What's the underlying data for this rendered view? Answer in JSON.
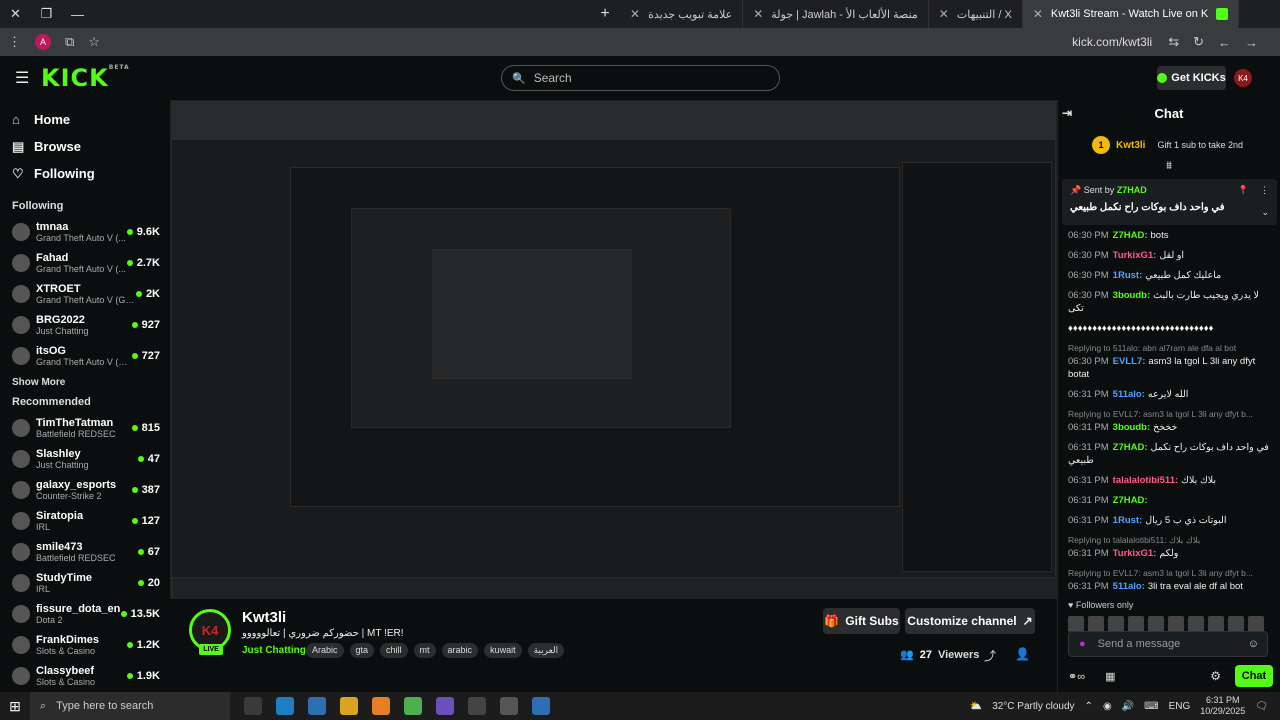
{
  "browser": {
    "tabs": [
      {
        "label": "علامة تبويب جديدة",
        "active": false
      },
      {
        "label": "جولة | Jawlah - منصة الألعاب الأ",
        "active": false
      },
      {
        "label": "التنبيهات / X",
        "active": false
      },
      {
        "label": "Kwt3li Stream - Watch Live on K",
        "active": true
      }
    ],
    "url": "kick.com/kwt3li",
    "profile_initial": "A"
  },
  "header": {
    "logo": "KICK",
    "beta": "BETA",
    "search_placeholder": "Search",
    "get_kicks": "Get KICKs",
    "user_avatar": "K4"
  },
  "sidebar": {
    "nav": [
      {
        "label": "Home",
        "icon": "home-icon"
      },
      {
        "label": "Browse",
        "icon": "browse-icon"
      },
      {
        "label": "Following",
        "icon": "heart-icon"
      }
    ],
    "following_title": "Following",
    "following": [
      {
        "name": "tmnaa",
        "game": "Grand Theft Auto V (...",
        "viewers": "9.6K"
      },
      {
        "name": "Fahad",
        "game": "Grand Theft Auto V (...",
        "viewers": "2.7K"
      },
      {
        "name": "XTROET",
        "game": "Grand Theft Auto V (GTA)",
        "viewers": "2K"
      },
      {
        "name": "BRG2022",
        "game": "Just Chatting",
        "viewers": "927"
      },
      {
        "name": "itsOG",
        "game": "Grand Theft Auto V (G...",
        "viewers": "727"
      }
    ],
    "show_more": "Show More",
    "recommended_title": "Recommended",
    "recommended": [
      {
        "name": "TimTheTatman",
        "game": "Battlefield REDSEC",
        "viewers": "815"
      },
      {
        "name": "Slashley",
        "game": "Just Chatting",
        "viewers": "47"
      },
      {
        "name": "galaxy_esports",
        "game": "Counter-Strike 2",
        "viewers": "387"
      },
      {
        "name": "Siratopia",
        "game": "IRL",
        "viewers": "127"
      },
      {
        "name": "smile473",
        "game": "Battlefield REDSEC",
        "viewers": "67"
      },
      {
        "name": "StudyTime",
        "game": "IRL",
        "viewers": "20"
      },
      {
        "name": "fissure_dota_en",
        "game": "Dota 2",
        "viewers": "13.5K"
      },
      {
        "name": "FrankDimes",
        "game": "Slots & Casino",
        "viewers": "1.2K"
      },
      {
        "name": "Classybeef",
        "game": "Slots & Casino",
        "viewers": "1.9K"
      }
    ]
  },
  "stream": {
    "avatar_text": "K4",
    "live": "LIVE",
    "name": "Kwt3li",
    "title": "حضوركم ضروري | تعالووووو | MT !ER!",
    "category": "Just Chatting",
    "tags": [
      "Arabic",
      "gta",
      "chill",
      "mt",
      "arabic",
      "kuwait",
      "العربية"
    ],
    "gift_subs": "Gift Subs",
    "customize": "Customize channel",
    "viewers": "27",
    "viewers_label": "Viewers"
  },
  "chat": {
    "title": "Chat",
    "top_gifter": "Kwt3li",
    "gift_prompt": "Gift 1 sub to take 2nd",
    "pinned_by_label": "Sent by",
    "pinned_by": "Z7HAD",
    "pinned_msg": "في واحد داف بوكات راح نكمل طبيعي",
    "messages": [
      {
        "time": "06:30 PM",
        "user": "Z7HAD:",
        "color": "#53fc18",
        "text": "bots",
        "reply": ""
      },
      {
        "time": "06:30 PM",
        "user": "TurkixG1:",
        "color": "#ff5c8a",
        "text": "او لقل",
        "reply": ""
      },
      {
        "time": "06:30 PM",
        "user": "1Rust:",
        "color": "#4da3ff",
        "text": "ماعليك كمل طبيعي",
        "reply": ""
      },
      {
        "time": "06:30 PM",
        "user": "3boudb:",
        "color": "#53fc18",
        "text": "لا يدري ويجيب طارت بالبث تكى",
        "reply": ""
      },
      {
        "time": "",
        "user": "",
        "color": "#eee",
        "text": "♦♦♦♦♦♦♦♦♦♦♦♦♦♦♦♦♦♦♦♦♦♦♦♦♦♦♦♦♦♦",
        "reply": ""
      },
      {
        "time": "06:30 PM",
        "user": "EVLL7:",
        "color": "#4da3ff",
        "text": "asm3 la tgol L 3li any dfyt botat",
        "reply": "Replying to 511alo: abn al7ram ale dfa al bot"
      },
      {
        "time": "06:31 PM",
        "user": "511alo:",
        "color": "#4da3ff",
        "text": "الله لايرعه",
        "reply": ""
      },
      {
        "time": "06:31 PM",
        "user": "3boudb:",
        "color": "#53fc18",
        "text": "خخخخ",
        "reply": "Replying to EVLL7: asm3 la tgol L 3li any dfyt b..."
      },
      {
        "time": "06:31 PM",
        "user": "Z7HAD:",
        "color": "#53fc18",
        "text": "في واحد داف بوكات راح نكمل طبيعي",
        "reply": ""
      },
      {
        "time": "06:31 PM",
        "user": "talalalotibi511:",
        "color": "#ff5c8a",
        "text": "بلاك بلاك",
        "reply": ""
      },
      {
        "time": "06:31 PM",
        "user": "Z7HAD:",
        "color": "#53fc18",
        "text": "",
        "reply": ""
      },
      {
        "time": "06:31 PM",
        "user": "1Rust:",
        "color": "#4da3ff",
        "text": "البوتات ذي ب 5 ريال",
        "reply": ""
      },
      {
        "time": "06:31 PM",
        "user": "TurkixG1:",
        "color": "#ff5c8a",
        "text": "ولكم",
        "reply": "Replying to talalalotibi511: بلاك بلاك"
      },
      {
        "time": "06:31 PM",
        "user": "511alo:",
        "color": "#4da3ff",
        "text": "3li tra eval ale df al bot",
        "reply": "Replying to EVLL7: asm3 la tgol L 3li any dfyt b..."
      }
    ],
    "followers_only": "Followers only",
    "send_placeholder": "Send a message",
    "chat_button": "Chat"
  },
  "taskbar": {
    "search_placeholder": "Type here to search",
    "weather": "32°C Partly cloudy",
    "lang": "ENG",
    "time": "6:31 PM",
    "date": "10/29/2025"
  },
  "colors": {
    "accent": "#53fc18",
    "gold": "#f0b90b",
    "bg": "#0b0e0f"
  }
}
